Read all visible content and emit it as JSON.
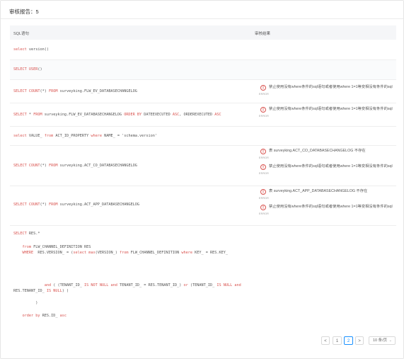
{
  "title": "审核报告：5",
  "table": {
    "col_sql": "SQL语句",
    "col_result": "审核结果"
  },
  "rows": [
    {
      "sql": "select version()",
      "results": []
    },
    {
      "sql": "SELECT USER()",
      "results": []
    },
    {
      "sql": "SELECT COUNT(*) FROM surveyking.FLW_EV_DATABASECHANGELOG",
      "results": [
        "禁止使用没有where条件的sql语句或者使用where 1=1等变相没有条件的sql"
      ]
    },
    {
      "sql": "SELECT * FROM surveyking.FLW_EV_DATABASECHANGELOG ORDER BY DATEEXECUTED ASC, ORDEREXECUTED ASC",
      "results": [
        "禁止使用没有where条件的sql语句或者使用where 1=1等变相没有条件的sql"
      ]
    },
    {
      "sql": "select VALUE_ from ACT_ID_PROPERTY where NAME_ = 'schema.version'",
      "results": []
    },
    {
      "sql": "SELECT COUNT(*) FROM surveyking.ACT_CO_DATABASECHANGELOG",
      "results": [
        "表 surveyking.ACT_CO_DATABASECHANGELOG 不存在",
        "禁止使用没有where条件的sql语句或者使用where 1=1等变相没有条件的sql"
      ]
    },
    {
      "sql": "SELECT COUNT(*) FROM surveyking.ACT_APP_DATABASECHANGELOG",
      "results": [
        "表 surveyking.ACT_APP_DATABASECHANGELOG 不存在",
        "禁止使用没有where条件的sql语句或者使用where 1=1等变相没有条件的sql"
      ]
    }
  ],
  "error_label": "ERROR",
  "multi_sql": [
    "SELECT RES.*",
    "    from FLW_CHANNEL_DEFINITION RES",
    "    WHERE  RES.VERSION_ = (select max(VERSION_) from FLW_CHANNEL_DEFINITION where KEY_ = RES.KEY_",
    "              and ( (TENANT_ID_ IS NOT NULL and TENANT_ID_ = RES.TENANT_ID_) or (TENANT_ID_ IS NULL and",
    "RES.TENANT_ID_ IS NULL) )",
    "          )",
    "    order by RES.ID_ asc"
  ],
  "pagination": {
    "prev": "<",
    "pages": [
      "1",
      "2"
    ],
    "current": "2",
    "next": ">",
    "page_size": "10 条/页"
  }
}
